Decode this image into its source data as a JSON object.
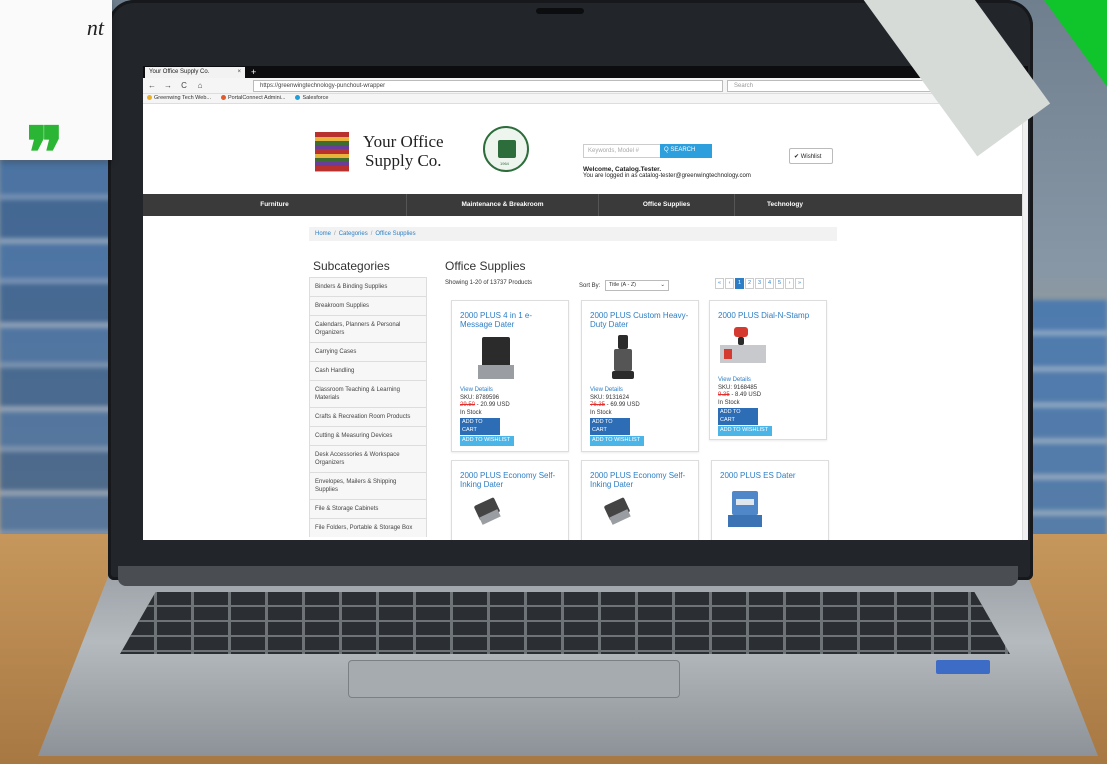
{
  "overlay": {
    "quote_text_fragment": "nt",
    "quote_marks": "❞"
  },
  "browser": {
    "tab_title": "Your Office Supply Co.",
    "tab_close": "×",
    "new_tab": "+",
    "back": "←",
    "forward": "→",
    "reload": "C",
    "home": "⌂",
    "url": "https://greenwingtechnology-punchout-wrapper",
    "search_placeholder": "Search",
    "menu": "≡",
    "bookmarks": [
      {
        "label": "Greenwing Tech Web...",
        "color": "#e8b02a"
      },
      {
        "label": "PortalConnect Admini...",
        "color": "#e25b2c"
      },
      {
        "label": "Salesforce",
        "color": "#1fa0dc"
      }
    ]
  },
  "site": {
    "logo_line1": "Your Office",
    "logo_line2": "Supply Co.",
    "search_placeholder": "Keywords, Model #",
    "search_button": "Q SEARCH",
    "welcome": "Welcome, Catalog.Tester.",
    "logged_in": "You are logged in as catalog-tester@greenwingtechnology.com",
    "wishlist_button": "✔ Wishlist",
    "seal_year": "1964"
  },
  "nav": {
    "items": [
      "Furniture",
      "Maintenance & Breakroom",
      "Office Supplies",
      "Technology"
    ]
  },
  "breadcrumb": {
    "items": [
      "Home",
      "Categories",
      "Office Supplies"
    ],
    "separator": "/"
  },
  "subcategories": {
    "title": "Subcategories",
    "items": [
      "Binders & Binding Supplies",
      "Breakroom Supplies",
      "Calendars, Planners & Personal Organizers",
      "Carrying Cases",
      "Cash Handling",
      "Classroom Teaching & Learning Materials",
      "Crafts & Recreation Room Products",
      "Cutting & Measuring Devices",
      "Desk Accessories & Workspace Organizers",
      "Envelopes, Mailers & Shipping Supplies",
      "File & Storage Cabinets",
      "File Folders, Portable & Storage Box"
    ]
  },
  "listing": {
    "title": "Office Supplies",
    "showing": "Showing 1-20 of 13737 Products",
    "sort_label": "Sort By:",
    "sort_value": "Title (A - Z)",
    "pager": [
      "«",
      "‹",
      "1",
      "2",
      "3",
      "4",
      "5",
      "›",
      "»"
    ],
    "active_page": "1"
  },
  "products": [
    {
      "title": "2000 PLUS 4 in 1 e-Message Dater",
      "view": "View Details",
      "sku": "SKU: 8789596",
      "old_price": "29.50",
      "price": " - 20.99 USD",
      "stock": "In Stock",
      "cart": "ADD TO CART",
      "wish": "ADD TO WISHLIST"
    },
    {
      "title": "2000 PLUS Custom Heavy-Duty Dater",
      "view": "View Details",
      "sku": "SKU: 9131624",
      "old_price": "76.35",
      "price": " - 69.99 USD",
      "stock": "In Stock",
      "cart": "ADD TO CART",
      "wish": "ADD TO WISHLIST"
    },
    {
      "title": "2000 PLUS Dial-N-Stamp",
      "view": "View Details",
      "sku": "SKU: 9168485",
      "old_price": "9.35",
      "price": " - 8.49 USD",
      "stock": "In Stock",
      "cart": "ADD TO CART",
      "wish": "ADD TO WISHLIST"
    },
    {
      "title": "2000 PLUS Economy Self-Inking Dater"
    },
    {
      "title": "2000 PLUS Economy Self-Inking Dater"
    },
    {
      "title": "2000 PLUS ES Dater"
    }
  ],
  "colors": {
    "link_blue": "#2d7ec4",
    "nav_dark": "#3a3a3a",
    "cart_button": "#2d6db5",
    "wishlist_button": "#4cb5e8",
    "sale_red": "#e03030",
    "brand_green": "#10c52c"
  }
}
